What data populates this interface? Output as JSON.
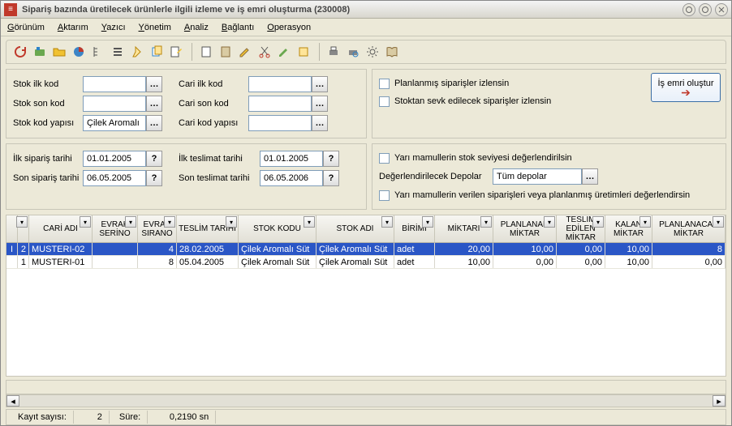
{
  "title": "Sipariş bazında üretilecek ürünlerle ilgili izleme ve iş emri oluşturma (230008)",
  "menu": [
    "Görünüm",
    "Aktarım",
    "Yazıcı",
    "Yönetim",
    "Analiz",
    "Bağlantı",
    "Operasyon"
  ],
  "filters": {
    "stok_ilk_kod_label": "Stok ilk kod",
    "stok_ilk_kod": "",
    "cari_ilk_kod_label": "Cari ilk kod",
    "cari_ilk_kod": "",
    "stok_son_kod_label": "Stok son kod",
    "stok_son_kod": "",
    "cari_son_kod_label": "Cari son kod",
    "cari_son_kod": "",
    "stok_kod_yapisi_label": "Stok kod yapısı",
    "stok_kod_yapisi": "Çilek Aromalı Süt",
    "cari_kod_yapisi_label": "Cari kod yapısı",
    "cari_kod_yapisi": "",
    "ilk_siparis_label": "İlk sipariş tarihi",
    "ilk_siparis": "01.01.2005",
    "ilk_teslimat_label": "İlk teslimat tarihi",
    "ilk_teslimat": "01.01.2005",
    "son_siparis_label": "Son sipariş tarihi",
    "son_siparis": "06.05.2005",
    "son_teslimat_label": "Son teslimat tarihi",
    "son_teslimat": "06.05.2006"
  },
  "options": {
    "chk_planlanmis": "Planlanmış siparişler izlensin",
    "chk_stoktan": "Stoktan sevk edilecek siparişler izlensin",
    "chk_yari_stok": "Yarı mamullerin stok seviyesi değerlendirilsin",
    "depolar_label": "Değerlendirilecek Depolar",
    "depolar_value": "Tüm depolar",
    "chk_yari_siparis": "Yarı mamullerin verilen siparişleri veya planlanmış üretimleri değerlendirsin"
  },
  "action_btn": "İş emri oluştur",
  "columns": [
    "",
    "",
    "CARİ ADI",
    "EVRAK SERİNO",
    "EVRAK SIRANO",
    "TESLİM TARİHİ",
    "STOK KODU",
    "STOK ADI",
    "BİRİMİ",
    "MİKTARI",
    "PLANLANAN MİKTAR",
    "TESLİM EDİLEN MİKTAR",
    "KALAN MİKTAR",
    "PLANLANACAK MİKTAR"
  ],
  "rows": [
    {
      "rn": "2",
      "cari": "MUSTERI-02",
      "serino": "",
      "sirano": "4",
      "tarih": "28.02.2005",
      "stokkod": "Çilek Aromalı Süt",
      "stokad": "Çilek Aromalı Süt",
      "birim": "adet",
      "miktar": "20,00",
      "planlanan": "10,00",
      "teslim": "0,00",
      "kalan": "10,00",
      "planlanacak": "8",
      "sel": true
    },
    {
      "rn": "1",
      "cari": "MUSTERI-01",
      "serino": "",
      "sirano": "8",
      "tarih": "05.04.2005",
      "stokkod": "Çilek Aromalı Süt",
      "stokad": "Çilek Aromalı Süt",
      "birim": "adet",
      "miktar": "10,00",
      "planlanan": "0,00",
      "teslim": "0,00",
      "kalan": "10,00",
      "planlanacak": "0,00",
      "sel": false
    }
  ],
  "status": {
    "kayit_label": "Kayıt sayısı:",
    "kayit_val": "2",
    "sure_label": "Süre:",
    "sure_val": "0,2190 sn"
  }
}
